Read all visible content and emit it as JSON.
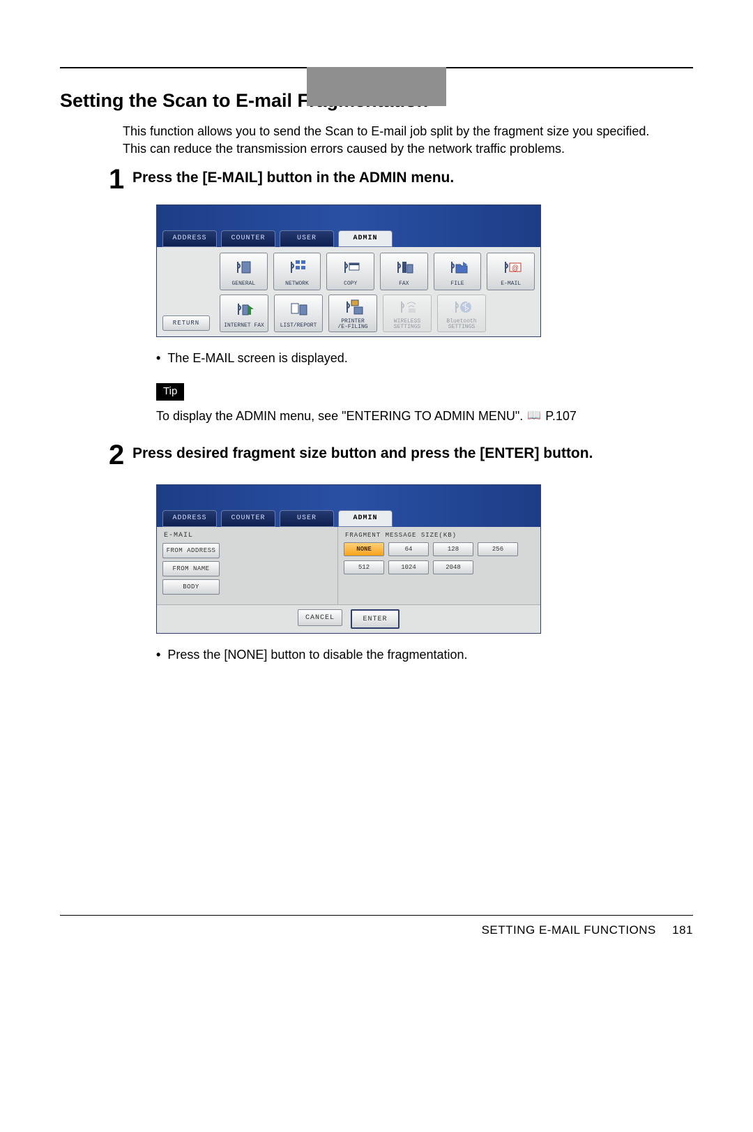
{
  "header_tab_placeholder": "",
  "section_title": "Setting the Scan to E-mail Fragmentation",
  "intro_line1": "This function allows you to send the Scan to E-mail job split by the fragment size you specified.",
  "intro_line2": "This can reduce the transmission errors caused by the network traffic problems.",
  "step1": {
    "num": "1",
    "title": "Press the [E-MAIL] button in the ADMIN menu.",
    "bullet1": "The E-MAIL screen is displayed.",
    "screen": {
      "tabs": {
        "address": "ADDRESS",
        "counter": "COUNTER",
        "user": "USER",
        "admin": "ADMIN"
      },
      "row1": {
        "general": "GENERAL",
        "network": "NETWORK",
        "copy": "COPY",
        "fax": "FAX",
        "file": "FILE",
        "email": "E-MAIL"
      },
      "row2": {
        "return": "RETURN",
        "ifax": "INTERNET FAX",
        "list": "LIST/REPORT",
        "printer": "PRINTER\n/E-FILING",
        "wireless": "WIRELESS\nSETTINGS",
        "bt": "Bluetooth\nSETTINGS"
      }
    }
  },
  "tip_label": "Tip",
  "tip_text": "To display the ADMIN menu, see \"ENTERING TO ADMIN MENU\".",
  "tip_ref": "P.107",
  "step2": {
    "num": "2",
    "title": "Press desired fragment size button and press the [ENTER] button.",
    "bullet1": "Press the [NONE] button to disable the fragmentation.",
    "screen": {
      "tabs": {
        "address": "ADDRESS",
        "counter": "COUNTER",
        "user": "USER",
        "admin": "ADMIN"
      },
      "left_title": "E-MAIL",
      "left_btns": {
        "fromaddr": "FROM ADDRESS",
        "fromname": "FROM NAME",
        "body": "BODY"
      },
      "right_head": "FRAGMENT MESSAGE SIZE(KB)",
      "opts": {
        "none": "NONE",
        "v64": "64",
        "v128": "128",
        "v256": "256",
        "v512": "512",
        "v1024": "1024",
        "v2048": "2048"
      },
      "dlg": {
        "cancel": "CANCEL",
        "enter": "ENTER"
      }
    }
  },
  "footer": {
    "label": "SETTING E-MAIL FUNCTIONS",
    "page": "181"
  }
}
